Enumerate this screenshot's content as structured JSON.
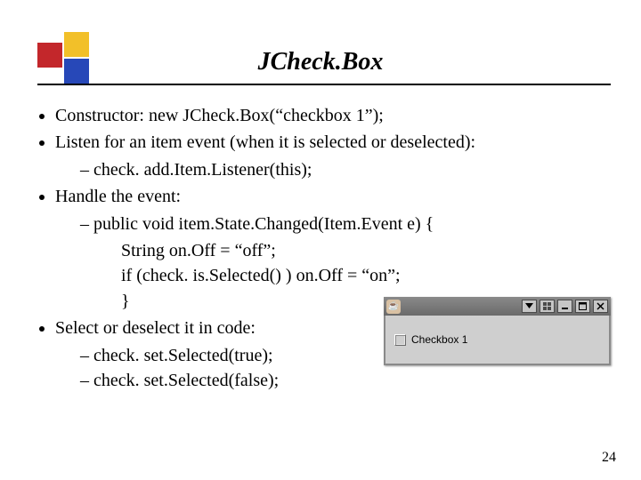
{
  "title": "JCheck.Box",
  "bullets": {
    "b0": "Constructor: new JCheck.Box(“checkbox 1”);",
    "b1": "Listen for an item event (when it is selected or deselected):",
    "b1_1": "check. add.Item.Listener(this);",
    "b2": "Handle the event:",
    "b2_1": "public void item.State.Changed(Item.Event e) {",
    "b2_code1": "String on.Off = “off”;",
    "b2_code2": "if (check. is.Selected() ) on.Off = “on”;",
    "b2_code3": "}",
    "b3": "Select or deselect it in code:",
    "b3_1": "check. set.Selected(true);",
    "b3_2": "check. set.Selected(false);"
  },
  "applet": {
    "checkbox_label": "Checkbox 1"
  },
  "page_number": "24"
}
